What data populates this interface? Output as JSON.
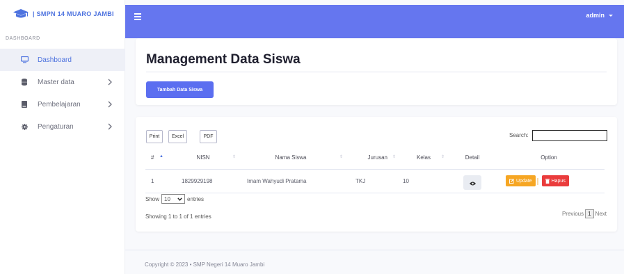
{
  "brand": {
    "icon": "graduation-cap-icon",
    "text": "| SMPN 14 MUARO JAMBI"
  },
  "sidebar": {
    "heading": "DASHBOARD",
    "items": [
      {
        "label": "Dashboard",
        "icon": "monitor-icon",
        "active": true
      },
      {
        "label": "Master data",
        "icon": "database-icon",
        "has_chevron": true
      },
      {
        "label": "Pembelajaran",
        "icon": "book-icon",
        "has_chevron": true
      },
      {
        "label": "Pengaturan",
        "icon": "gear-icon",
        "has_chevron": true
      }
    ]
  },
  "topbar": {
    "menu_icon": "hamburger-icon",
    "user": "admin"
  },
  "header": {
    "title": "Management Data Siswa",
    "add_button": "Tambah Data Siswa"
  },
  "table_tools": {
    "export_buttons": [
      "Print",
      "Excel",
      "PDF"
    ],
    "search_label": "Search:",
    "search_value": ""
  },
  "table": {
    "columns": [
      "#",
      "NISN",
      "Nama Siswa",
      "Jurusan",
      "Kelas",
      "Detail",
      "Option"
    ],
    "rows": [
      {
        "no": "1",
        "nisn": "1829929198",
        "nama": "Imam Wahyudi Pratama",
        "jurusan": "TKJ",
        "kelas": "10"
      }
    ],
    "update_label": "Update",
    "hapus_label": "Hapus"
  },
  "pagination": {
    "show_label": "Show",
    "page_size": "10",
    "entries_label": "entries",
    "info": "Showing 1 to 1 of 1 entries",
    "previous": "Previous",
    "current_page": "1",
    "next": "Next"
  },
  "footer": {
    "text": "Copyright © 2023  • SMP Negeri 14 Muaro Jambi"
  },
  "colors": {
    "accent": "#4e73df",
    "topbar": "#6576ef",
    "update": "#f6a623",
    "hapus": "#ea3c3c"
  }
}
